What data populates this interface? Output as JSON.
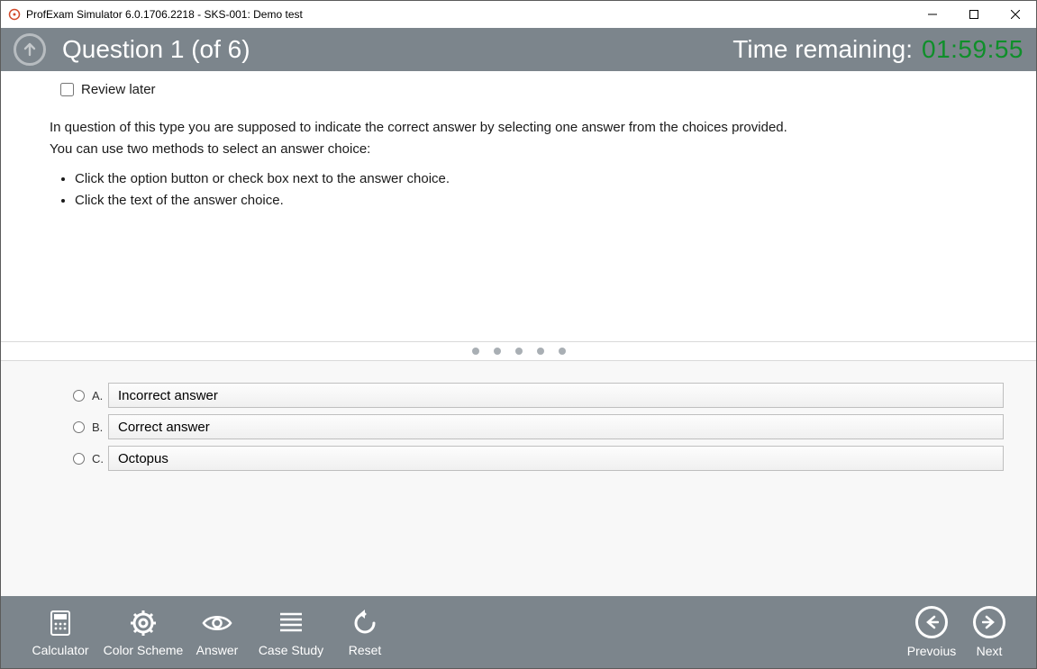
{
  "window": {
    "title": "ProfExam Simulator 6.0.1706.2218 - SKS-001: Demo test"
  },
  "header": {
    "question_label": "Question  1 (of 6)",
    "time_label": "Time remaining:",
    "time_value": "01:59:55"
  },
  "question": {
    "review_label": "Review later",
    "intro_line1": "In question of this type you are supposed to  indicate the correct answer by selecting one answer from the choices provided.",
    "intro_line2": "You can use two methods to select an answer choice:",
    "bullets": [
      "Click the option button or check box next to the answer choice.",
      "Click the text of the answer choice."
    ]
  },
  "answers": [
    {
      "letter": "A.",
      "text": "Incorrect answer"
    },
    {
      "letter": "B.",
      "text": "Correct answer"
    },
    {
      "letter": "C.",
      "text": "Octopus"
    }
  ],
  "toolbar": {
    "calculator": "Calculator",
    "color_scheme": "Color Scheme",
    "answer": "Answer",
    "case_study": "Case Study",
    "reset": "Reset",
    "previous": "Prevoius",
    "next": "Next"
  }
}
